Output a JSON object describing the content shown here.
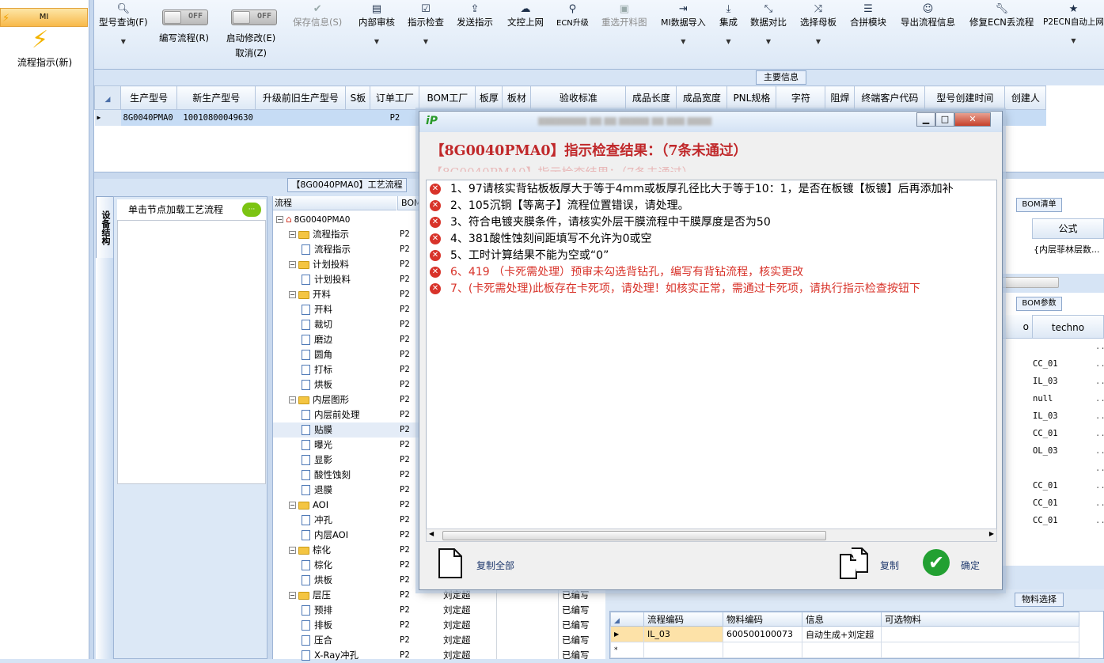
{
  "left_panel": {
    "tab_label": "MI",
    "item_label": "流程指示(新)"
  },
  "toolbar": {
    "buttons": [
      {
        "label": "型号查询(F)",
        "icon": "search-icon"
      },
      {
        "label": "保存信息(S)",
        "icon": "check-icon",
        "disabled": true
      },
      {
        "label": "内部审核",
        "icon": "printer-icon"
      },
      {
        "label": "指示检查",
        "icon": "checkbox-icon"
      },
      {
        "label": "发送指示",
        "icon": "upload-icon"
      },
      {
        "label": "文控上网",
        "icon": "cloud-upload-icon"
      },
      {
        "label": "ECN升级",
        "icon": "binoculars-icon"
      },
      {
        "label": "重选开料图",
        "icon": "image-icon",
        "disabled": true
      },
      {
        "label": "MI数据导入",
        "icon": "sign-in-icon"
      },
      {
        "label": "集成",
        "icon": "download-icon"
      },
      {
        "label": "数据对比",
        "icon": "compress-icon"
      },
      {
        "label": "选择母板",
        "icon": "random-icon"
      },
      {
        "label": "合拼模块",
        "icon": "list-icon"
      },
      {
        "label": "导出流程信息",
        "icon": "smile-icon"
      },
      {
        "label": "修复ECN丢流程",
        "icon": "wrench-icon"
      },
      {
        "label": "P2ECN自动上网",
        "icon": "star-icon"
      }
    ],
    "toggles": [
      {
        "state": "OFF",
        "label": "编写流程(R)"
      },
      {
        "state": "OFF",
        "label": "启动修改(E)",
        "label2": "取消(Z)"
      }
    ]
  },
  "main_info": {
    "header": "主要信息",
    "columns": [
      "生产型号",
      "新生产型号",
      "升级前旧生产型号",
      "S板",
      "订单工厂",
      "BOM工厂",
      "板厚",
      "板材",
      "验收标准",
      "成品长度",
      "成品宽度",
      "PNL规格",
      "字符",
      "阻焊",
      "终端客户代码",
      "型号创建时间",
      "创建人"
    ],
    "row": [
      "8G0040PMA0",
      "10010800049630",
      "",
      "",
      "P2",
      "",
      "",
      "",
      "",
      "",
      "",
      "",
      "",
      "",
      "",
      "",
      ""
    ]
  },
  "flow_panel": {
    "header": "【8G0040PMA0】工艺流程",
    "vertical_tab": "设备结构",
    "node_hint": "单击节点加载工艺流程",
    "tree_col_flow": "流程",
    "tree_col_bom": "BOM",
    "tree": [
      {
        "label": "8G0040PMA0",
        "level": 0,
        "type": "root",
        "bom": ""
      },
      {
        "label": "流程指示",
        "level": 1,
        "type": "folder",
        "bom": "P2"
      },
      {
        "label": "流程指示",
        "level": 2,
        "type": "doc",
        "bom": "P2"
      },
      {
        "label": "计划投料",
        "level": 1,
        "type": "folder",
        "bom": "P2"
      },
      {
        "label": "计划投料",
        "level": 2,
        "type": "doc",
        "bom": "P2"
      },
      {
        "label": "开料",
        "level": 1,
        "type": "folder",
        "bom": "P2"
      },
      {
        "label": "开料",
        "level": 2,
        "type": "doc",
        "bom": "P2"
      },
      {
        "label": "裁切",
        "level": 2,
        "type": "doc",
        "bom": "P2"
      },
      {
        "label": "磨边",
        "level": 2,
        "type": "doc",
        "bom": "P2"
      },
      {
        "label": "圆角",
        "level": 2,
        "type": "doc",
        "bom": "P2"
      },
      {
        "label": "打标",
        "level": 2,
        "type": "doc",
        "bom": "P2"
      },
      {
        "label": "烘板",
        "level": 2,
        "type": "doc",
        "bom": "P2"
      },
      {
        "label": "内层图形",
        "level": 1,
        "type": "folder",
        "bom": "P2"
      },
      {
        "label": "内层前处理",
        "level": 2,
        "type": "doc",
        "bom": "P2"
      },
      {
        "label": "贴膜",
        "level": 2,
        "type": "doc",
        "bom": "P2",
        "selected": true
      },
      {
        "label": "曝光",
        "level": 2,
        "type": "doc",
        "bom": "P2"
      },
      {
        "label": "显影",
        "level": 2,
        "type": "doc",
        "bom": "P2"
      },
      {
        "label": "酸性蚀刻",
        "level": 2,
        "type": "doc",
        "bom": "P2"
      },
      {
        "label": "退膜",
        "level": 2,
        "type": "doc",
        "bom": "P2"
      },
      {
        "label": "AOI",
        "level": 1,
        "type": "folder",
        "bom": "P2"
      },
      {
        "label": "冲孔",
        "level": 2,
        "type": "doc",
        "bom": "P2"
      },
      {
        "label": "内层AOI",
        "level": 2,
        "type": "doc",
        "bom": "P2"
      },
      {
        "label": "棕化",
        "level": 1,
        "type": "folder",
        "bom": "P2"
      },
      {
        "label": "棕化",
        "level": 2,
        "type": "doc",
        "bom": "P2"
      },
      {
        "label": "烘板",
        "level": 2,
        "type": "doc",
        "bom": "P2"
      },
      {
        "label": "层压",
        "level": 1,
        "type": "folder",
        "bom": "P2"
      },
      {
        "label": "预排",
        "level": 2,
        "type": "doc",
        "bom": "P2"
      },
      {
        "label": "排板",
        "level": 2,
        "type": "doc",
        "bom": "P2"
      },
      {
        "label": "压合",
        "level": 2,
        "type": "doc",
        "bom": "P2"
      },
      {
        "label": "X-Ray冲孔",
        "level": 2,
        "type": "doc",
        "bom": "P2"
      }
    ],
    "behind_rows": [
      {
        "name": "刘定超",
        "status": "已编写"
      },
      {
        "name": "刘定超",
        "status": "已编写"
      },
      {
        "name": "刘定超",
        "status": "已编写"
      },
      {
        "name": "刘定超",
        "status": "已编写"
      },
      {
        "name": "刘定超",
        "status": "已编写"
      }
    ]
  },
  "bom_list": {
    "header": "BOM清单",
    "col_formula": "公式",
    "formula_value": "{内层菲林层数..."
  },
  "bom_params": {
    "header": "BOM参数",
    "col_partial": "o",
    "col_techno": "techno",
    "values": [
      "",
      "CC_01",
      "IL_03",
      "null",
      "IL_03",
      "CC_01",
      "OL_03",
      "",
      "CC_01",
      "CC_01",
      "CC_01"
    ]
  },
  "material": {
    "header": "物料选择",
    "columns": [
      "流程编码",
      "物料编码",
      "信息",
      "可选物料"
    ],
    "rows": [
      [
        "IL_03",
        "600500100073",
        "自动生成+刘定超",
        ""
      ]
    ]
  },
  "dialog": {
    "heading": "【8G0040PMA0】指示检查结果：（7条未通过）",
    "ghost_text": "【8G0040PMA0】指示检查结果：（7条未通过）",
    "messages": [
      {
        "text": "1、97请核实背钻板板厚大于等于4mm或板厚孔径比大于等于10：1，是否在板镀【板镀】后再添加补",
        "red": false
      },
      {
        "text": "2、105沉铜【等离子】流程位置错误，请处理。",
        "red": false
      },
      {
        "text": "3、符合电镀夹膜条件，请核实外层干膜流程中干膜厚度是否为50",
        "red": false
      },
      {
        "text": "4、381酸性蚀刻间距填写不允许为0或空",
        "red": false
      },
      {
        "text": "5、工时计算结果不能为空或“0”",
        "red": false
      },
      {
        "text": "6、419 （卡死需处理）预审未勾选背钻孔，编写有背钻流程，核实更改",
        "red": true
      },
      {
        "text": "7、(卡死需处理)此板存在卡死项，请处理！如核实正常，需通过卡死项，请执行指示检查按钮下",
        "red": true
      }
    ],
    "copy_all_label": "复制全部",
    "copy_label": "复制",
    "ok_label": "确定"
  }
}
